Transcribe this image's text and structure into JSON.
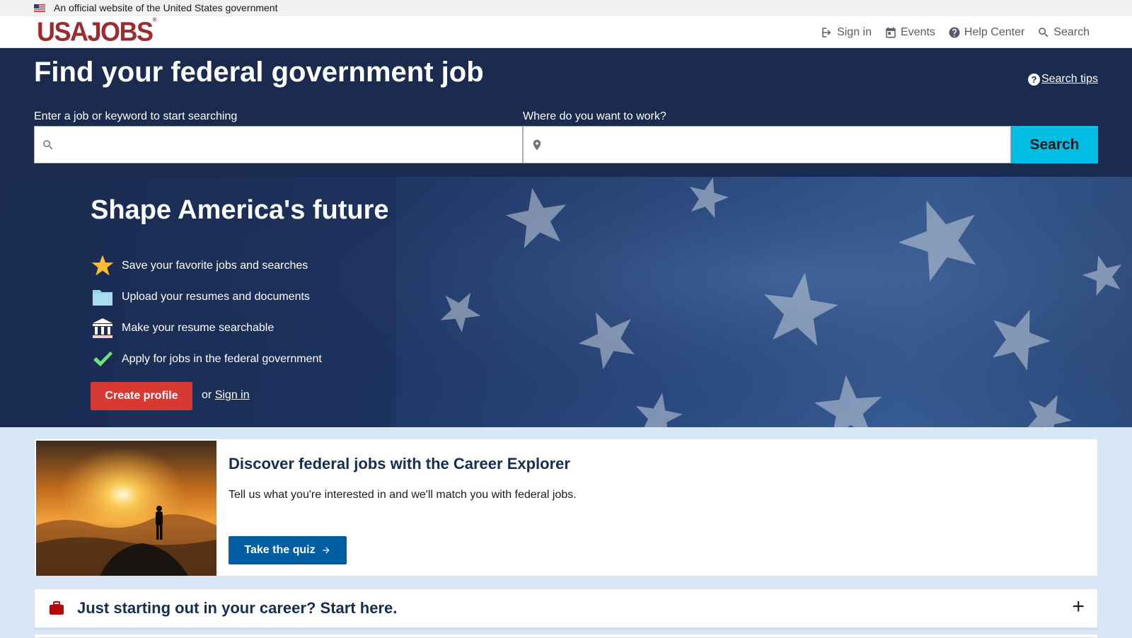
{
  "gov_banner": {
    "text": "An official website of the United States government"
  },
  "header": {
    "logo": "USAJOBS",
    "logo_mark": "®",
    "nav": [
      {
        "label": "Sign in",
        "icon": "sign-in-icon"
      },
      {
        "label": "Events",
        "icon": "calendar-icon"
      },
      {
        "label": "Help Center",
        "icon": "help-icon"
      },
      {
        "label": "Search",
        "icon": "search-icon"
      }
    ]
  },
  "hero": {
    "title": "Find your federal government job",
    "search_tips": "Search tips",
    "keyword_label": "Enter a job or keyword to start searching",
    "keyword_value": "",
    "location_label": "Where do you want to work?",
    "location_value": "",
    "search_button": "Search"
  },
  "promo": {
    "title": "Shape America's future",
    "benefits": [
      {
        "text": "Save your favorite jobs and searches",
        "icon": "star-icon",
        "color": "#ffbe2e"
      },
      {
        "text": "Upload your resumes and documents",
        "icon": "folder-icon",
        "color": "#97d4ea"
      },
      {
        "text": "Make your resume searchable",
        "icon": "government-building-icon",
        "color": "#ffffff"
      },
      {
        "text": "Apply for jobs in the federal government",
        "icon": "checkmark-icon",
        "color": "#70e17b"
      }
    ],
    "create_button": "Create profile",
    "or_text": "or",
    "signin_link": "Sign in"
  },
  "career_card": {
    "title": "Discover federal jobs with the Career Explorer",
    "text": "Tell us what you're interested in and we'll match you with federal jobs.",
    "button": "Take the quiz"
  },
  "accordion": {
    "title": "Just starting out in your career? Start here.",
    "icon": "briefcase-icon",
    "toggle": "+"
  },
  "colors": {
    "brand_red": "#9c2c2f",
    "hero_navy": "#1b2b4f",
    "search_cyan": "#00bde3",
    "create_red": "#d83933",
    "quiz_blue": "#005ea2",
    "page_bg": "#d9e8f6"
  }
}
